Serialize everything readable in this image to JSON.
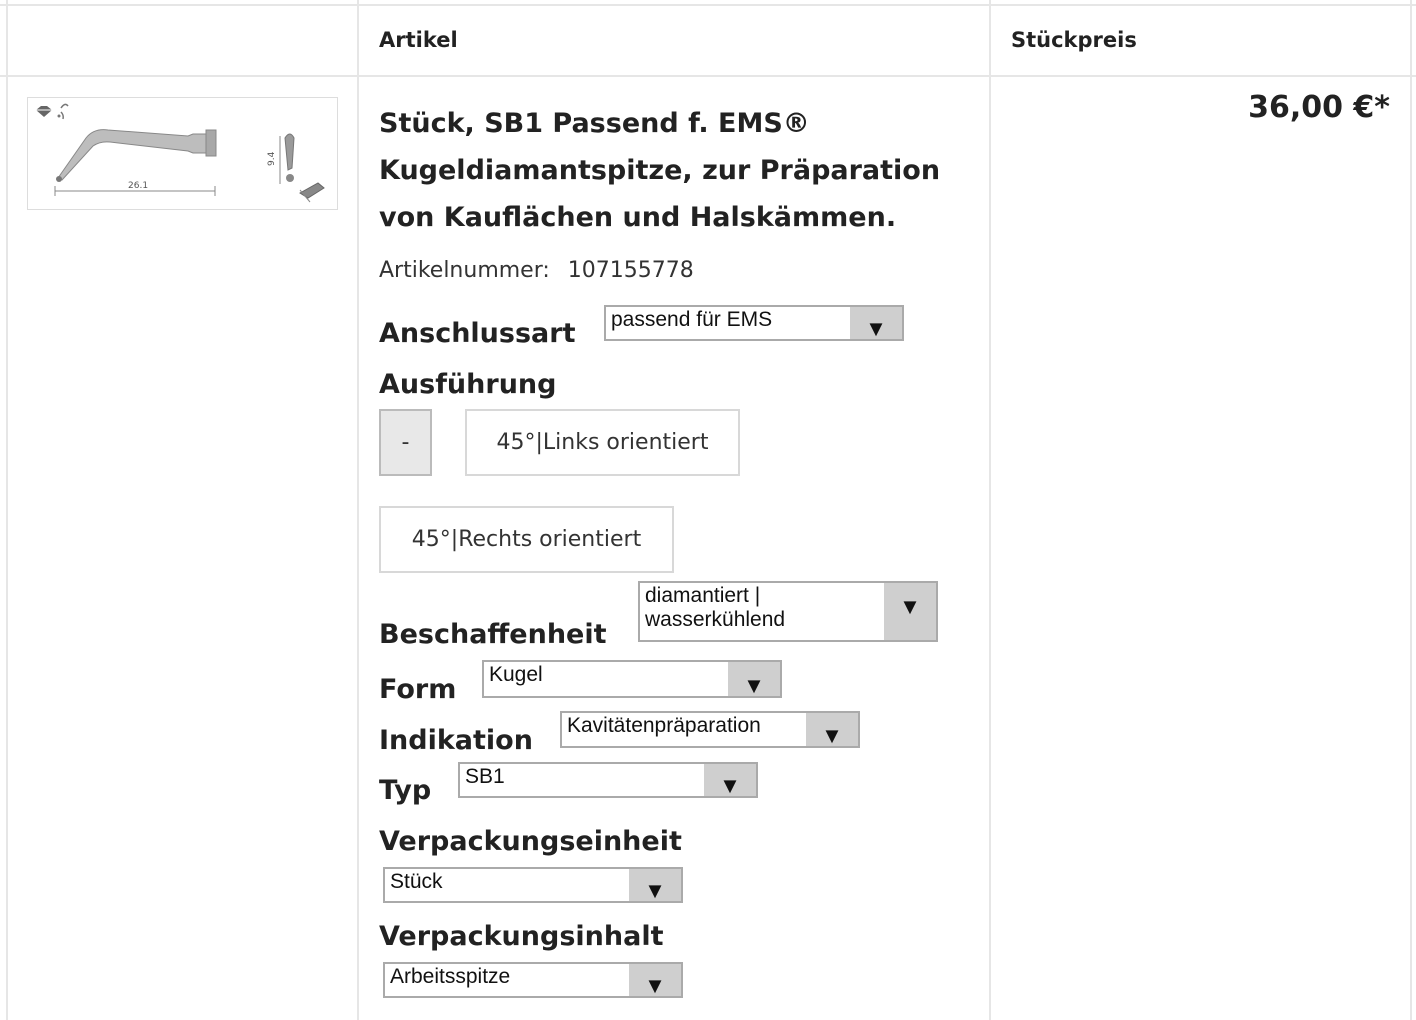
{
  "table": {
    "columns": [
      "",
      "Artikel",
      "Stückpreis"
    ]
  },
  "product": {
    "image_alt": "SB1 Arbeitsspitze",
    "dim_length": "26.1",
    "dim_height": "9.4",
    "title": "Stück, SB1 Passend f. EMS® Kugeldiamantspitze, zur Präparation von Kauflächen und Halskämmen.",
    "article_number_label": "Artikelnummer:",
    "article_number": "107155778",
    "price": "36,00 €*"
  },
  "options": {
    "anschlussart": {
      "label": "Anschlussart",
      "value": "passend für EMS"
    },
    "ausfuehrung": {
      "label": "Ausführung",
      "choices": [
        "-",
        "45°|Links orientiert",
        "45°|Rechts orientiert"
      ]
    },
    "beschaffenheit": {
      "label": "Beschaffenheit",
      "value_line1": "diamantiert |",
      "value_line2": "wasserkühlend"
    },
    "form": {
      "label": "Form",
      "value": "Kugel"
    },
    "indikation": {
      "label": "Indikation",
      "value": "Kavitätenpräparation"
    },
    "typ": {
      "label": "Typ",
      "value": "SB1"
    },
    "verpackungseinheit": {
      "label": "Verpackungseinheit",
      "value": "Stück"
    },
    "verpackungsinhalt": {
      "label": "Verpackungsinhalt",
      "value": "Arbeitsspitze"
    }
  },
  "icons": {
    "dropdown": "triangle-down-icon",
    "diamond": "diamond-icon",
    "water": "water-drop-icon"
  },
  "colors": {
    "border": "#e6e6e6",
    "select_arrow_bg": "#cfcfcf",
    "text": "#222222"
  }
}
